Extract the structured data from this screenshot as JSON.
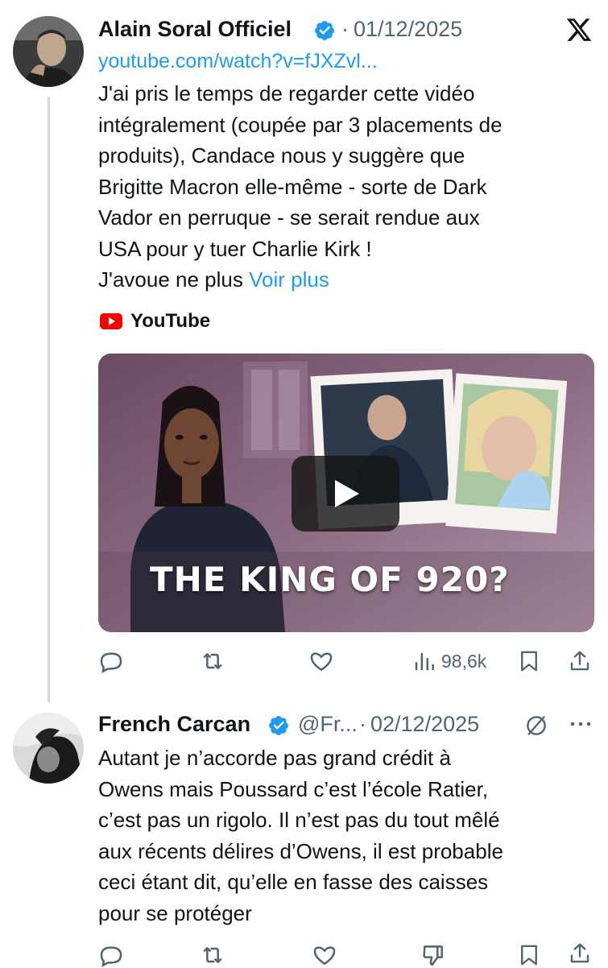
{
  "tweet1": {
    "author_name": "Alain Soral Officiel",
    "separator": "·",
    "date": "01/12/2025",
    "link": "youtube.com/watch?v=fJXZvl...",
    "lines": [
      "J'ai pris le temps de regarder cette vidéo",
      "intégralement (coupée par 3 placements de",
      "produits), Candace nous y suggère que",
      "Brigitte Macron elle-même - sorte de Dark",
      "Vador en perruque  - se serait rendue aux",
      "USA pour y tuer Charlie Kirk !"
    ],
    "last_line_start": "J'avoue ne plus ",
    "see_more": "Voir plus",
    "source_label": "YouTube",
    "thumbnail_caption": "THE KING OF 920?",
    "views": "98,6k"
  },
  "tweet2": {
    "author_name": "French Carcan",
    "handle": "@Fr...",
    "separator": "·",
    "date": "02/12/2025",
    "lines": [
      "Autant je n’accorde pas grand crédit à",
      "Owens mais Poussard c’est l’école Ratier,",
      "c’est pas un rigolo. Il n’est pas du tout mêlé",
      "aux récents délires d’Owens, il est probable",
      "ceci étant dit, qu’elle en fasse des caisses",
      "pour se protéger"
    ]
  },
  "icons": {
    "verified": "verified-badge-icon",
    "x_logo": "x-logo-icon",
    "youtube": "youtube-icon",
    "play": "play-icon",
    "reply": "reply-icon",
    "repost": "repost-icon",
    "like": "like-icon",
    "views": "views-icon",
    "bookmark": "bookmark-icon",
    "share": "share-icon",
    "grok": "grok-icon",
    "more": "more-icon",
    "dislike": "dislike-icon"
  },
  "colors": {
    "accent": "#1d9bf0",
    "text": "#0f1419",
    "secondary": "#536471",
    "youtube_red": "#ff0000"
  }
}
